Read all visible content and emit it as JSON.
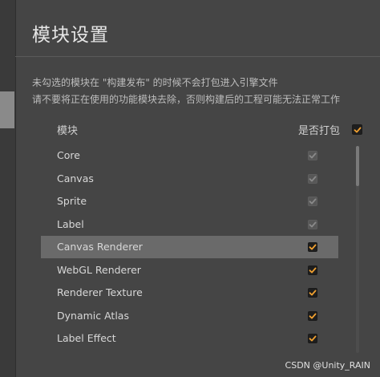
{
  "panel": {
    "title": "模块设置",
    "description_line1": "未勾选的模块在 \"构建发布\" 的时候不会打包进入引擎文件",
    "description_line2": "请不要将正在使用的功能模块去除，否则构建后的工程可能无法正常工作",
    "column_module": "模块",
    "column_pack": "是否打包",
    "pack_all_checked": true
  },
  "modules": [
    {
      "label": "Core",
      "checked": true,
      "disabled": true,
      "selected": false
    },
    {
      "label": "Canvas",
      "checked": true,
      "disabled": true,
      "selected": false
    },
    {
      "label": "Sprite",
      "checked": true,
      "disabled": true,
      "selected": false
    },
    {
      "label": "Label",
      "checked": true,
      "disabled": true,
      "selected": false
    },
    {
      "label": "Canvas Renderer",
      "checked": true,
      "disabled": false,
      "selected": true
    },
    {
      "label": "WebGL Renderer",
      "checked": true,
      "disabled": false,
      "selected": false
    },
    {
      "label": "Renderer Texture",
      "checked": true,
      "disabled": false,
      "selected": false
    },
    {
      "label": "Dynamic Atlas",
      "checked": true,
      "disabled": false,
      "selected": false
    },
    {
      "label": "Label Effect",
      "checked": true,
      "disabled": false,
      "selected": false
    }
  ],
  "colors": {
    "check_enabled": "#f0a030",
    "check_disabled": "#8a8a8a",
    "selected_row": "#6a6a6a"
  },
  "watermark": "CSDN @Unity_RAIN"
}
